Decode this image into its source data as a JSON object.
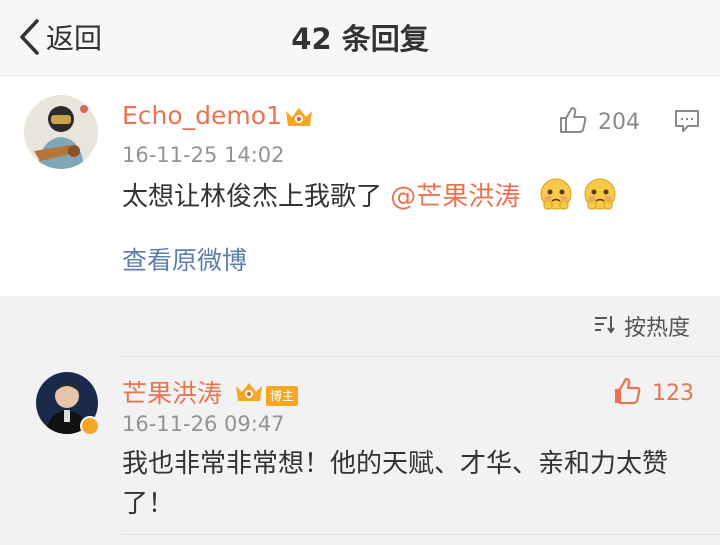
{
  "header": {
    "back_label": "返回",
    "title": "42 条回复"
  },
  "post": {
    "username": "Echo_demo1",
    "time": "16-11-25 14:02",
    "text": "太想让林俊杰上我歌了",
    "mention": "@芒果洪涛",
    "likes": "204",
    "view_original": "查看原微博"
  },
  "sort": {
    "label": "按热度"
  },
  "reply": {
    "username": "芒果洪涛",
    "badge": "博主",
    "time": "16-11-26 09:47",
    "text": "我也非常非常想！他的天赋、才华、亲和力太赞了！",
    "likes": "123"
  },
  "colors": {
    "accent": "#eb7350",
    "link": "#5d7fad",
    "vip": "#f5a623"
  }
}
